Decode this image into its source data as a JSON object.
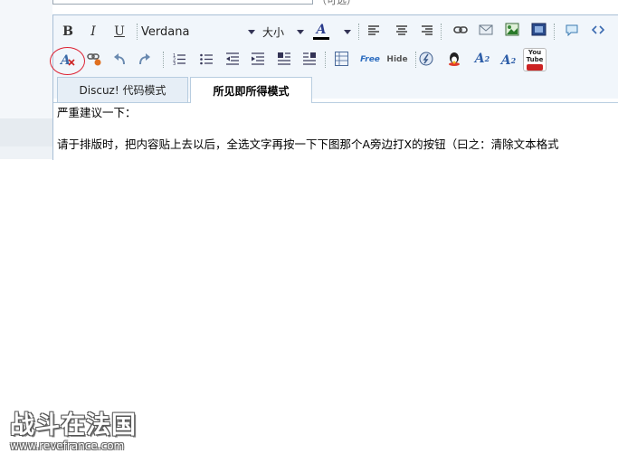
{
  "form": {
    "top_hint": "（可选）"
  },
  "toolbar": {
    "bold_label": "B",
    "italic_label": "I",
    "underline_label": "U",
    "font_family": "Verdana",
    "font_size_label": "大小",
    "font_color_label": "A",
    "free_label": "Free",
    "hide_label": "Hide",
    "youtube_label": "You Tube",
    "superscript_label": "A",
    "subscript_label": "A",
    "font_color_value": "#000000"
  },
  "tabs": [
    {
      "label": "Discuz! 代码模式",
      "active": false
    },
    {
      "label": "所见即所得模式",
      "active": true
    }
  ],
  "content": {
    "line1": "严重建议一下：",
    "line2": "请于排版时，把内容贴上去以后，全选文字再按一下下图那个A旁边打X的按钮（曰之：清除文本格式"
  },
  "watermark": {
    "title": "战斗在法国",
    "url": "www.revefrance.com"
  }
}
